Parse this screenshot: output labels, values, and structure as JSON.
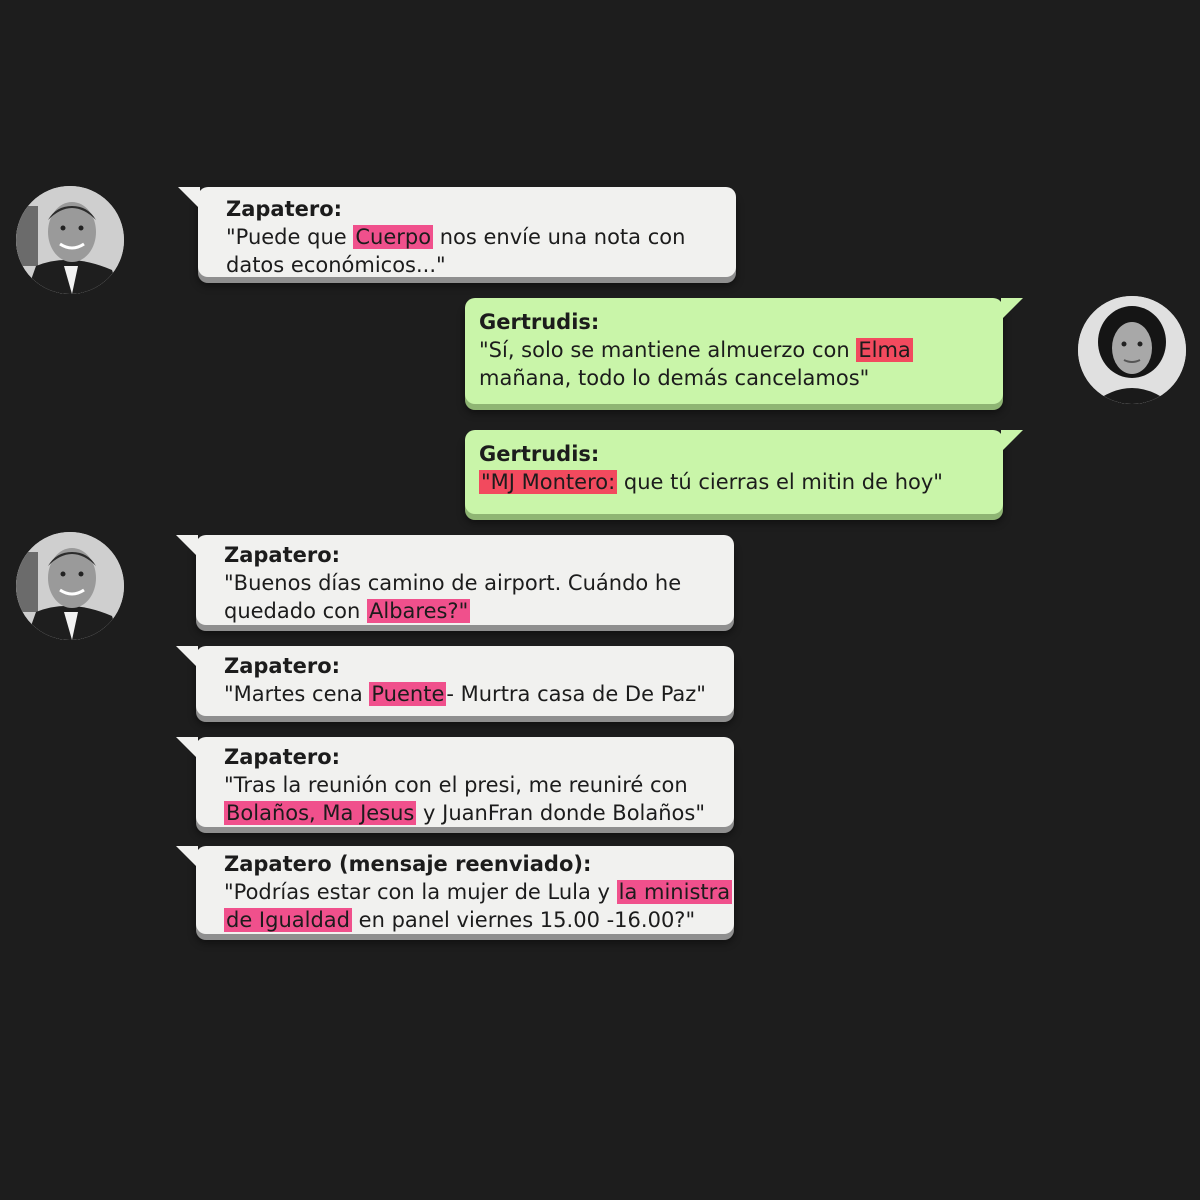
{
  "colors": {
    "background": "#1d1d1d",
    "incoming_bubble": "#f1f1ef",
    "outgoing_bubble": "#c9f5a9",
    "highlight_pink": "#f0508c",
    "highlight_red": "#f24a5e"
  },
  "avatars": {
    "zapatero": "zapatero-avatar",
    "gertrudis": "gertrudis-avatar"
  },
  "messages": [
    {
      "sender": "Zapatero:",
      "line1_a": "\"Puede que ",
      "line1_hl": "Cuerpo",
      "line1_b": " nos envíe una nota con",
      "line2": "datos económicos...\""
    },
    {
      "sender": "Gertrudis:",
      "line1_a": "\"Sí, solo se mantiene almuerzo con ",
      "line1_hl": "Elma",
      "line2": "mañana, todo lo demás cancelamos\""
    },
    {
      "sender": "Gertrudis:",
      "line1_hl": "\"MJ Montero:",
      "line1_b": " que tú cierras el mitin de hoy\""
    },
    {
      "sender": "Zapatero:",
      "line1": "\"Buenos días camino de airport. Cuándo he",
      "line2_a": "quedado con ",
      "line2_hl": "Albares?\""
    },
    {
      "sender": "Zapatero:",
      "line1_a": "\"Martes cena ",
      "line1_hl": "Puente",
      "line1_b": "- Murtra casa de De Paz\""
    },
    {
      "sender": "Zapatero:",
      "line1": "\"Tras la reunión con el presi, me reuniré con",
      "line2_hl": "Bolaños, Ma Jesus",
      "line2_b": " y JuanFran donde Bolaños\""
    },
    {
      "sender": "Zapatero (mensaje reenviado):",
      "line1_a": " \"Podrías estar con la mujer de Lula y ",
      "line1_hl": "la ministra",
      "line2_hl": "de Igualdad",
      "line2_b": " en panel viernes 15.00 -16.00?\""
    }
  ]
}
